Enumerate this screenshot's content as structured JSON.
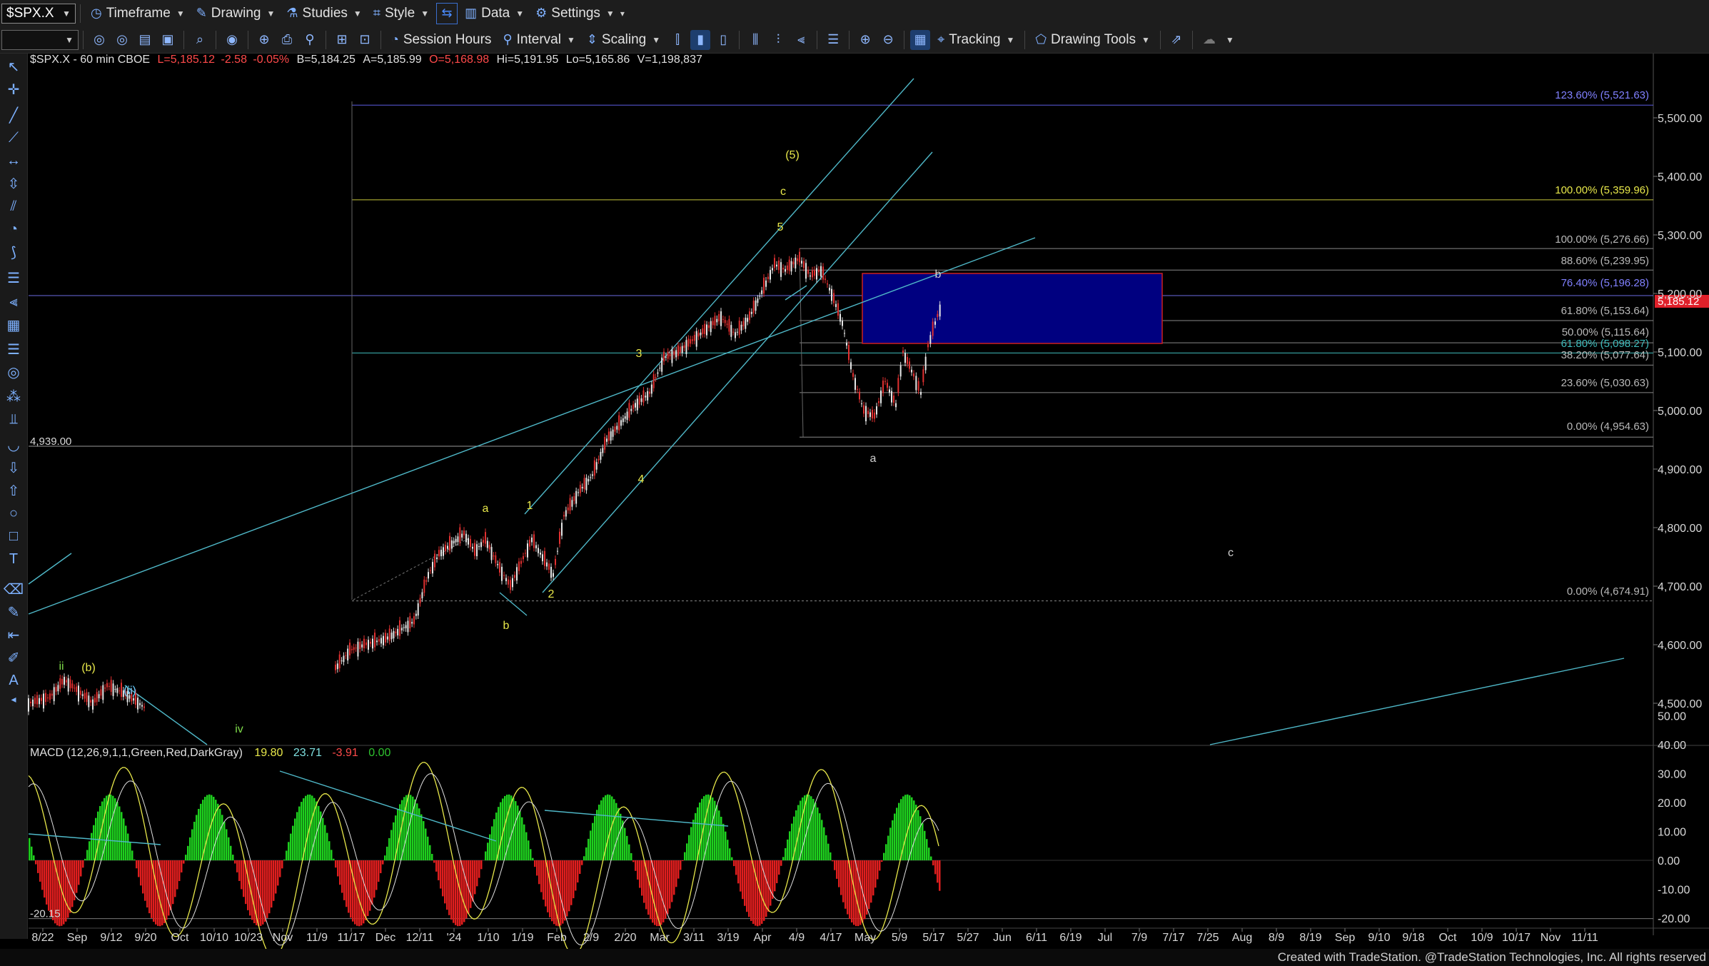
{
  "toolbar_top": {
    "symbol": "$SPX.X",
    "items": [
      {
        "label": "Timeframe",
        "icon": "clock-icon"
      },
      {
        "label": "Drawing",
        "icon": "pencil-icon"
      },
      {
        "label": "Studies",
        "icon": "flask-icon"
      },
      {
        "label": "Style",
        "icon": "style-icon"
      },
      {
        "label": "Data",
        "icon": "data-icon"
      },
      {
        "label": "Settings",
        "icon": "gear-icon"
      }
    ]
  },
  "toolbar_second": {
    "session_label": "Session Hours",
    "interval_label": "Interval",
    "scaling_label": "Scaling",
    "tracking_label": "Tracking",
    "drawing_tools_label": "Drawing Tools"
  },
  "header": {
    "title": "$SPX.X - 60 min  CBOE",
    "last": "L=5,185.12",
    "chg": "-2.58",
    "pct": "-0.05%",
    "bid": "B=5,184.25",
    "ask": "A=5,185.99",
    "open": "O=5,168.98",
    "high": "Hi=5,191.95",
    "low": "Lo=5,165.86",
    "volume": "V=1,198,837"
  },
  "price_axis": [
    "5,500.00",
    "5,400.00",
    "5,300.00",
    "5,200.00",
    "5,100.00",
    "5,000.00",
    "4,900.00",
    "4,800.00",
    "4,700.00",
    "4,600.00",
    "4,500.00"
  ],
  "current_price_tag": "5,185.12",
  "fib_labels": [
    {
      "text": "123.60% (5,521.63)",
      "color": "#8080ff"
    },
    {
      "text": "100.00% (5,359.96)",
      "color": "#e8e84a"
    },
    {
      "text": "100.00% (5,276.66)",
      "color": "#b8b8b8"
    },
    {
      "text": "88.60% (5,239.95)",
      "color": "#b8b8b8"
    },
    {
      "text": "76.40% (5,196.28)",
      "color": "#8080ff"
    },
    {
      "text": "61.80% (5,153.64)",
      "color": "#b8b8b8"
    },
    {
      "text": "50.00% (5,115.64)",
      "color": "#b8b8b8"
    },
    {
      "text": "61.80% (5,098.27)",
      "color": "#3fbcbc"
    },
    {
      "text": "38.20% (5,077.64)",
      "color": "#b8b8b8"
    },
    {
      "text": "23.60% (5,030.63)",
      "color": "#b8b8b8"
    },
    {
      "text": "0.00% (4,954.63)",
      "color": "#b8b8b8"
    },
    {
      "text": "0.00% (4,674.91)",
      "color": "#b8b8b8"
    }
  ],
  "level_label": "4,939.00",
  "wave_labels": [
    {
      "t": "(5)",
      "c": "#e8e84a"
    },
    {
      "t": "c",
      "c": "#e8e84a"
    },
    {
      "t": "5",
      "c": "#e8e84a"
    },
    {
      "t": "3",
      "c": "#e8e84a"
    },
    {
      "t": "4",
      "c": "#e8e84a"
    },
    {
      "t": "1",
      "c": "#e8e84a"
    },
    {
      "t": "2",
      "c": "#e8e84a"
    },
    {
      "t": "a",
      "c": "#e8e84a"
    },
    {
      "t": "b",
      "c": "#e8e84a"
    },
    {
      "t": "b",
      "c": "#d0d0d0"
    },
    {
      "t": "a",
      "c": "#d0d0d0"
    },
    {
      "t": "c",
      "c": "#d0d0d0"
    },
    {
      "t": "ii",
      "c": "#7fdc4a"
    },
    {
      "t": "(b)",
      "c": "#e8e84a"
    },
    {
      "t": "(ii)",
      "c": "#66ccff"
    },
    {
      "t": "iv",
      "c": "#7fdc4a"
    }
  ],
  "macd": {
    "label": "MACD (12,26,9,1,1,Green,Red,DarkGray)",
    "v1": "19.80",
    "v2": "23.71",
    "v3": "-3.91",
    "v4": "0.00",
    "axis": [
      "50.00",
      "40.00",
      "30.00",
      "20.00",
      "10.00",
      "0.00",
      "-10.00",
      "-20.00"
    ],
    "low_label": "-20.15"
  },
  "date_axis": [
    "8/22",
    "Sep",
    "9/12",
    "9/20",
    "Oct",
    "10/10",
    "10/23",
    "Nov",
    "11/9",
    "11/17",
    "Dec",
    "12/11",
    "'24",
    "1/10",
    "1/19",
    "Feb",
    "2/9",
    "2/20",
    "Mar",
    "3/11",
    "3/19",
    "Apr",
    "4/9",
    "4/17",
    "May",
    "5/9",
    "5/17",
    "5/27",
    "Jun",
    "6/11",
    "6/19",
    "Jul",
    "7/9",
    "7/17",
    "7/25",
    "Aug",
    "8/9",
    "8/19",
    "Sep",
    "9/10",
    "9/18",
    "Oct",
    "10/9",
    "10/17",
    "Nov",
    "11/11"
  ],
  "footer": "Created with TradeStation. @TradeStation Technologies, Inc. All rights reserved"
}
